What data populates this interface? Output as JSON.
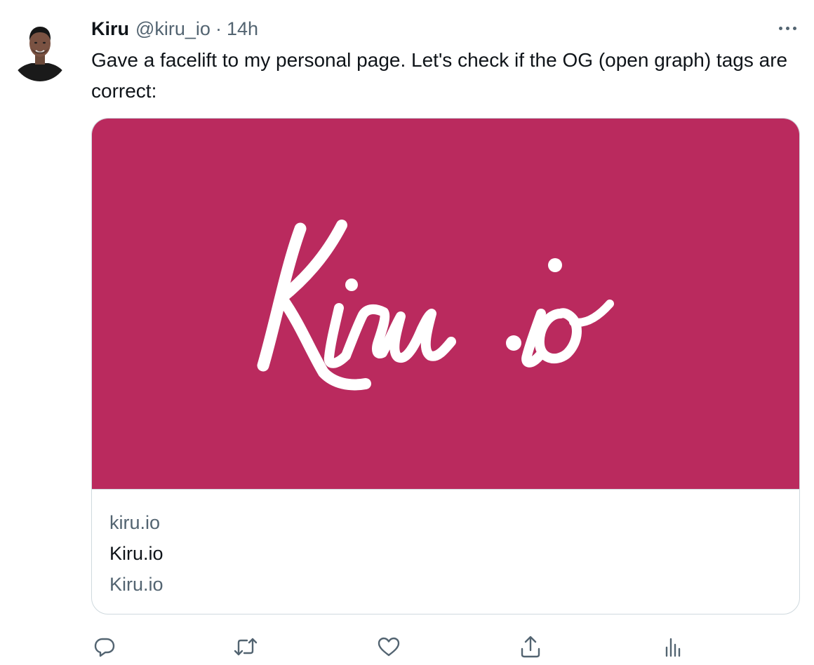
{
  "tweet": {
    "author": {
      "display_name": "Kiru",
      "handle": "@kiru_io",
      "separator": "·",
      "time": "14h",
      "avatar_icon": "profile-photo"
    },
    "more_icon": "more-horizontal-icon",
    "text": "Gave a facelift to my personal page. Let's check if the OG (open graph) tags are correct:"
  },
  "card": {
    "image_text": "Kiru.io",
    "image_background": "#ba2a5e",
    "domain": "kiru.io",
    "title": "Kiru.io",
    "description": "Kiru.io"
  },
  "actions": [
    {
      "name": "reply",
      "icon": "reply-icon"
    },
    {
      "name": "retweet",
      "icon": "retweet-icon"
    },
    {
      "name": "like",
      "icon": "heart-icon"
    },
    {
      "name": "share",
      "icon": "share-icon"
    },
    {
      "name": "analytics",
      "icon": "analytics-icon"
    }
  ],
  "colors": {
    "text_primary": "#0f1419",
    "text_secondary": "#536471",
    "border": "#cfd9de"
  }
}
